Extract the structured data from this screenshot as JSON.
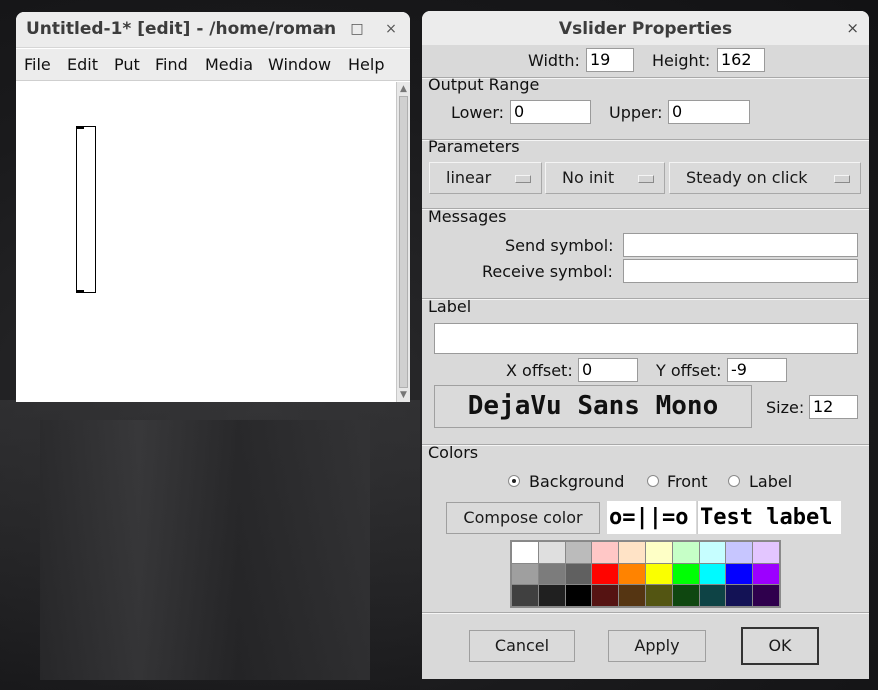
{
  "editor_window": {
    "title": "Untitled-1* [edit] - /home/roman",
    "minimize": "–",
    "maximize": "□",
    "close": "×",
    "menu": [
      "File",
      "Edit",
      "Put",
      "Find",
      "Media",
      "Window",
      "Help"
    ]
  },
  "dialog": {
    "title": "Vslider Properties",
    "close": "×",
    "size": {
      "width_label": "Width:",
      "width_value": "19",
      "height_label": "Height:",
      "height_value": "162"
    },
    "output_range": {
      "heading": "Output Range",
      "lower_label": "Lower:",
      "lower_value": "0",
      "upper_label": "Upper:",
      "upper_value": "0"
    },
    "parameters": {
      "heading": "Parameters",
      "scale": "linear",
      "init": "No init",
      "steady": "Steady on click"
    },
    "messages": {
      "heading": "Messages",
      "send_label": "Send symbol:",
      "send_value": "",
      "receive_label": "Receive symbol:",
      "receive_value": ""
    },
    "label": {
      "heading": "Label",
      "value": "",
      "x_offset_label": "X offset:",
      "x_offset_value": "0",
      "y_offset_label": "Y offset:",
      "y_offset_value": "-9",
      "font_button": "DejaVu Sans Mono",
      "size_label": "Size:",
      "size_value": "12"
    },
    "colors": {
      "heading": "Colors",
      "radio_background": "Background",
      "radio_front": "Front",
      "radio_label": "Label",
      "selected": "Background",
      "compose_button": "Compose color",
      "preview_slider": "o=||=o",
      "preview_label": "Test label",
      "palette": [
        "#ffffff",
        "#dfdfdf",
        "#bbbbbb",
        "#ffc7c6",
        "#ffe3c6",
        "#feffc6",
        "#c6ffc7",
        "#c6feff",
        "#c7c6ff",
        "#e3c6ff",
        "#9f9f9f",
        "#7c7c7c",
        "#606060",
        "#ff0400",
        "#ff8300",
        "#faff00",
        "#00ff04",
        "#00faff",
        "#0400ff",
        "#9c00ff",
        "#404040",
        "#202020",
        "#000000",
        "#551312",
        "#553512",
        "#535512",
        "#0f4710",
        "#0e4345",
        "#131255",
        "#2f004d"
      ]
    },
    "buttons": {
      "cancel": "Cancel",
      "apply": "Apply",
      "ok": "OK"
    }
  }
}
